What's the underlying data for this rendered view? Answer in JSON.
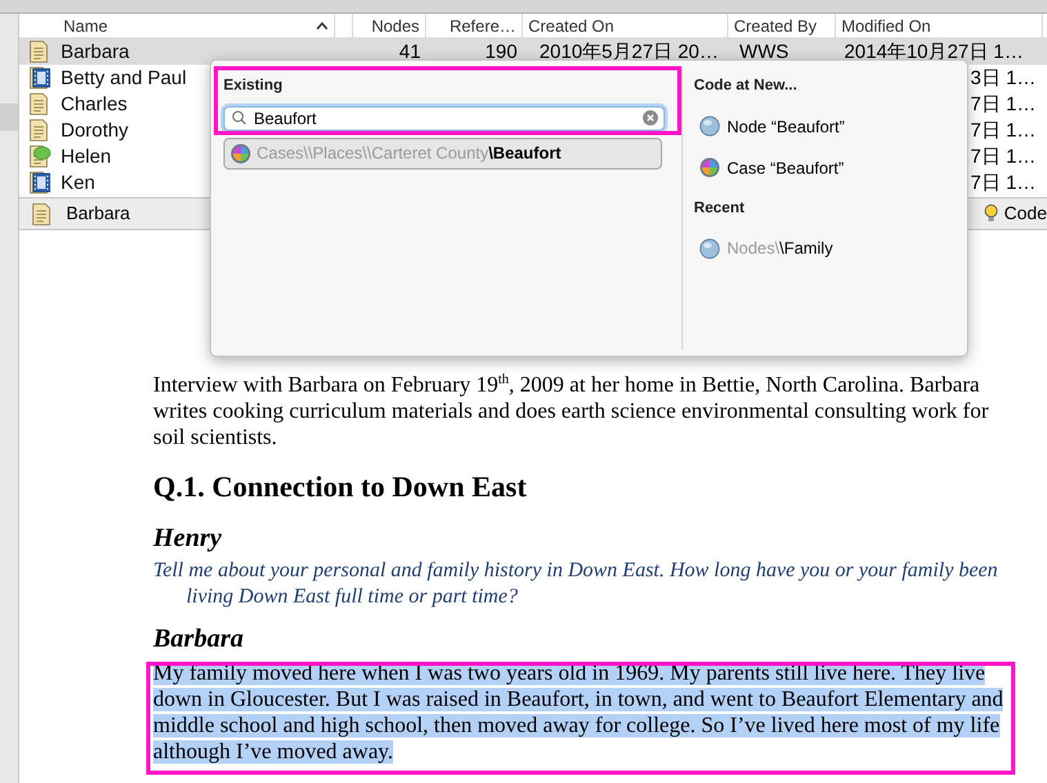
{
  "table": {
    "columns": [
      {
        "label": "Name",
        "sorted": true
      },
      {
        "sorted": false
      },
      {
        "label": "Nodes",
        "sorted": false
      },
      {
        "label": "Refere…",
        "sorted": false
      },
      {
        "label": "Created On",
        "sorted": false
      },
      {
        "label": "Created By",
        "sorted": false
      },
      {
        "label": "Modified On",
        "sorted": false
      }
    ],
    "rows": [
      {
        "kind": "document",
        "name": "Barbara",
        "selected": true,
        "nodes": "41",
        "references": "190",
        "created_on": "2010年5月27日 20…",
        "created_by": "WWS",
        "modified_on": "2014年10月27日 1…"
      },
      {
        "kind": "video",
        "name": "Betty and Paul",
        "selected": false,
        "modified_on": "3日 1…"
      },
      {
        "kind": "document",
        "name": "Charles",
        "selected": false,
        "modified_on": "7日 1…"
      },
      {
        "kind": "document",
        "name": "Dorothy",
        "selected": false,
        "modified_on": "7日 1…"
      },
      {
        "kind": "memo",
        "name": "Helen",
        "selected": false,
        "modified_on": "7日 1…"
      },
      {
        "kind": "video",
        "name": "Ken",
        "selected": false,
        "modified_on": "7日 1…"
      }
    ]
  },
  "source_bar": {
    "title": "Barbara",
    "code_button": "Code"
  },
  "popover": {
    "existing": {
      "label": "Existing",
      "search": {
        "value": "Beaufort"
      },
      "results": [
        {
          "kind": "case",
          "path": "Cases\\\\Places\\\\Carteret County",
          "name": "\\Beaufort"
        }
      ]
    },
    "code_at_new": {
      "label": "Code at New...",
      "items": [
        {
          "kind": "node",
          "label": "Node “Beaufort”"
        },
        {
          "kind": "case",
          "label": "Case “Beaufort”"
        }
      ]
    },
    "recent": {
      "label": "Recent",
      "items": [
        {
          "kind": "node",
          "path": "Nodes\\",
          "name": "\\Family"
        }
      ]
    }
  },
  "document": [
    {
      "kind": "paragraph",
      "text": "Interview with Barbara on February 19$^{th}$, 2009 at her home in Bettie, North Carolina. Barbara writes cooking curriculum materials and does earth science environmental consulting work for soil scientists.",
      "selected": false
    },
    {
      "kind": "heading",
      "text": "Q.1. Connection to Down East",
      "selected": false
    },
    {
      "kind": "speaker",
      "text": "Henry",
      "selected": false
    },
    {
      "kind": "question",
      "text": "Tell me about your personal and family history in Down East. How long have you or your family been living Down East full time or part time?",
      "selected": false
    },
    {
      "kind": "speaker",
      "text": "Barbara",
      "selected": false
    },
    {
      "kind": "paragraph",
      "text": "My family moved here when I was two years old in 1969. My parents still live here. They live down in Gloucester. But I was raised in Beaufort, in town, and went to Beaufort Elementary and middle school and high school, then moved away for college. So I’ve lived here most of my life although I’ve moved away.",
      "selected": true
    }
  ]
}
